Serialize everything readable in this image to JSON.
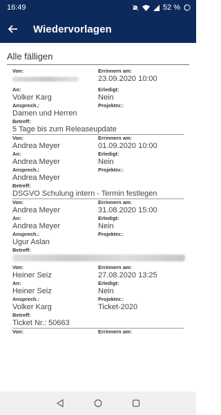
{
  "status": {
    "time": "16:49",
    "battery": "52 %"
  },
  "appbar": {
    "title": "Wiedervorlagen"
  },
  "section": {
    "title": "Alle fälligen"
  },
  "labels": {
    "von": "Von:",
    "an": "An:",
    "ansprech": "Ansprech.:",
    "betreff": "Betreff:",
    "erinnern": "Errinnern am:",
    "erledigt": "Erledigt:",
    "projekt": "Projektnr.:"
  },
  "records": [
    {
      "von": "",
      "erinnern": "23.09.2020 10:00",
      "an": "Volker Karg",
      "erledigt": "Nein",
      "ansprech": "Damen und Herren",
      "projekt": "",
      "betreff": "5 Tage bis zum Releaseupdate"
    },
    {
      "von": "Andrea Meyer",
      "erinnern": "01.09.2020 10:00",
      "an": "Andrea Meyer",
      "erledigt": "Nein",
      "ansprech": "Andrea Meyer",
      "projekt": "",
      "betreff": "DSGVO Schulung intern - Termin festlegen"
    },
    {
      "von": "Andrea Meyer",
      "erinnern": "31.08.2020 15:00",
      "an": "Andrea Meyer",
      "erledigt": "Nein",
      "ansprech": "Ugur Aslan",
      "projekt": "",
      "betreff": ""
    },
    {
      "von": "Heiner Seiz",
      "erinnern": "27.08.2020 13:25",
      "an": "Heiner Seiz",
      "erledigt": "Nein",
      "ansprech": "Volker Karg",
      "projekt": "Ticket-2020",
      "betreff": "Ticket Nr.: 50663"
    }
  ],
  "colors": {
    "primary": "#0d2a5c",
    "navbar": "#f0f0f0"
  },
  "icons": [
    "back-arrow-icon",
    "mute-icon",
    "wifi-icon",
    "signal-icon",
    "battery-icon",
    "nav-back-icon",
    "nav-home-icon",
    "nav-recents-icon"
  ]
}
